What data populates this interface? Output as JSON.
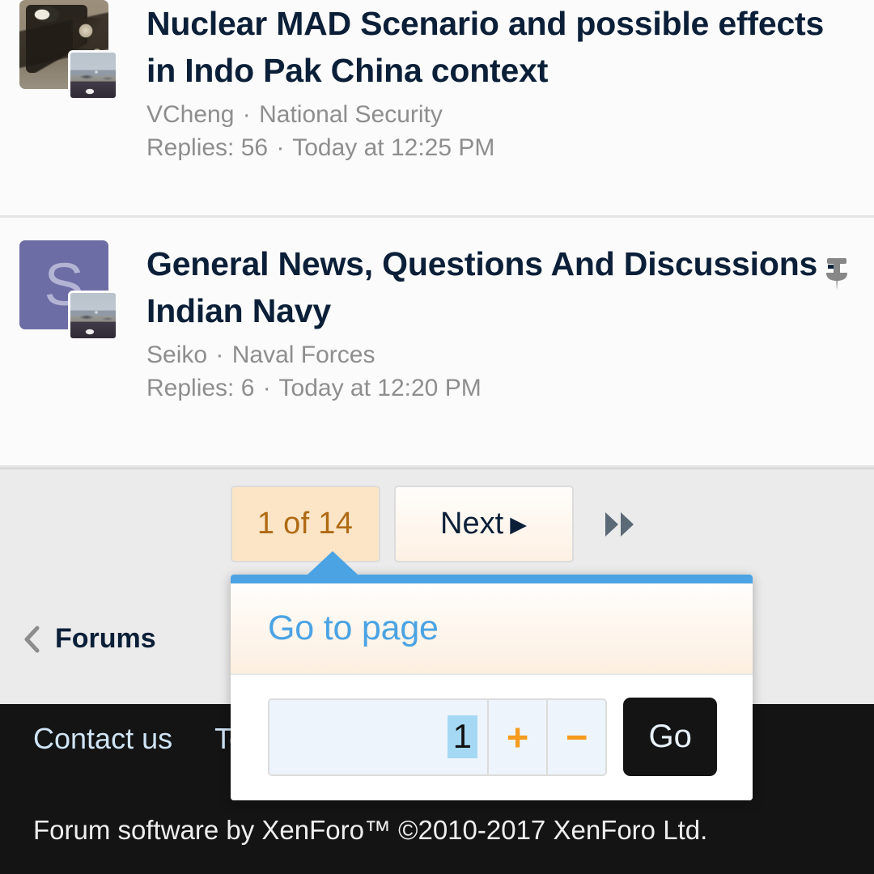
{
  "threads": [
    {
      "title": "Nuclear MAD Scenario and possible effects in Indo Pak China context",
      "author": "VCheng",
      "forum": "National Security",
      "replies_label": "Replies: 56",
      "timestamp": "Today at 12:25 PM",
      "separator": "·",
      "avatar_type": "photo",
      "avatar_letter": "",
      "sticky": false
    },
    {
      "title": "General News, Questions And Discussions - Indian Navy",
      "author": "Seiko",
      "forum": "Naval Forces",
      "replies_label": "Replies: 6",
      "timestamp": "Today at 12:20 PM",
      "separator": "·",
      "avatar_type": "letter",
      "avatar_letter": "S",
      "sticky": true,
      "sticky_icon": "pushpin-icon"
    }
  ],
  "pagination": {
    "current_page_label": "1 of 14",
    "current_page": 1,
    "total_pages": 14,
    "next_label": "Next",
    "next_caret": "▶",
    "last_page_icon": "double-chevron-right-icon",
    "accent_page_bg": "#fbe5c6",
    "accent_page_text": "#b06a14"
  },
  "breadcrumb": {
    "back_icon": "chevron-left-icon",
    "label": "Forums"
  },
  "goto_popup": {
    "title": "Go to page",
    "input_value": "1",
    "input_placeholder": "1",
    "increment_label": "+",
    "decrement_label": "−",
    "go_label": "Go",
    "accent_color": "#4ba3e3",
    "stepper_color": "#f59b1e"
  },
  "footer": {
    "links": [
      "Contact us",
      "Terms and rules"
    ],
    "copyright": "Forum software by XenForo™ ©2010-2017 XenForo Ltd.",
    "background": "#141414",
    "link_color": "#cfe4f5"
  }
}
